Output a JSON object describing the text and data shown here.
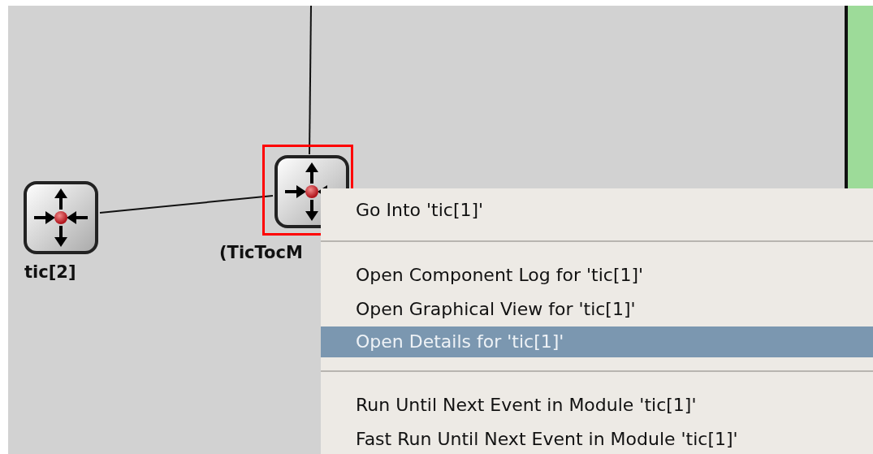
{
  "canvas": {
    "nodes": [
      {
        "label": "tic[2]",
        "selected": false
      },
      {
        "label": "(TicTocM",
        "selected": true
      }
    ]
  },
  "context_menu": {
    "items": [
      {
        "kind": "item",
        "label": "Go Into 'tic[1]'",
        "selected": false
      },
      {
        "kind": "separator"
      },
      {
        "kind": "item",
        "label": "Open Component Log for 'tic[1]'",
        "selected": false
      },
      {
        "kind": "item",
        "label": "Open Graphical View for 'tic[1]'",
        "selected": false
      },
      {
        "kind": "item",
        "label": "Open Details for 'tic[1]'",
        "selected": true
      },
      {
        "kind": "separator"
      },
      {
        "kind": "item",
        "label": "Run Until Next Event in Module 'tic[1]'",
        "selected": false
      },
      {
        "kind": "item",
        "label": "Fast Run Until Next Event in Module 'tic[1]'",
        "selected": false
      }
    ]
  }
}
